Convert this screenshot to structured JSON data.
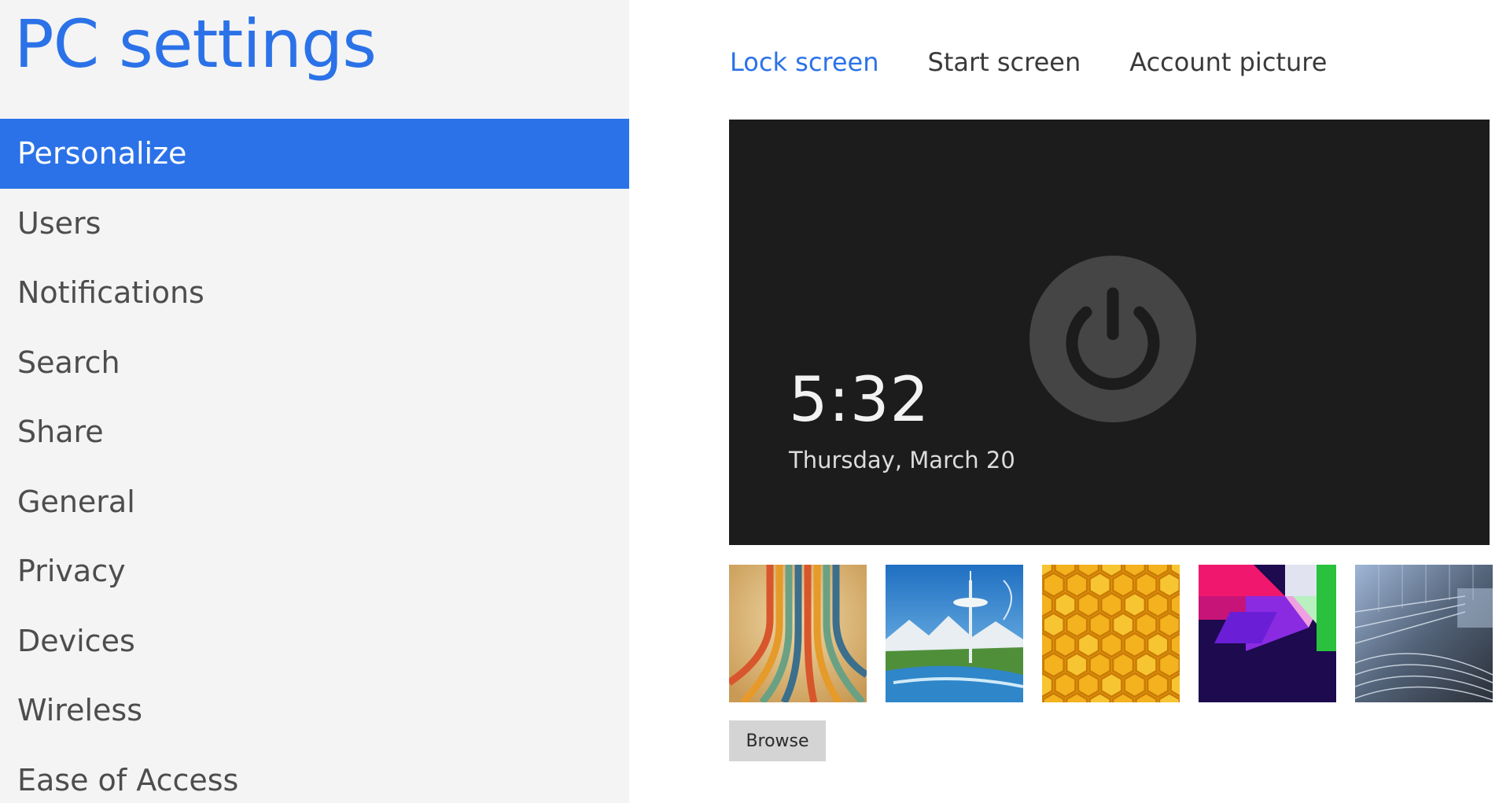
{
  "app": {
    "title": "PC settings"
  },
  "sidebar": {
    "items": [
      {
        "label": "Personalize",
        "selected": true
      },
      {
        "label": "Users"
      },
      {
        "label": "Notifications"
      },
      {
        "label": "Search"
      },
      {
        "label": "Share"
      },
      {
        "label": "General"
      },
      {
        "label": "Privacy"
      },
      {
        "label": "Devices"
      },
      {
        "label": "Wireless"
      },
      {
        "label": "Ease of Access"
      }
    ]
  },
  "main": {
    "tabs": [
      {
        "label": "Lock screen",
        "active": true
      },
      {
        "label": "Start screen"
      },
      {
        "label": "Account picture"
      }
    ],
    "preview": {
      "time": "5:32",
      "date": "Thursday, March 20",
      "icon": "power-icon"
    },
    "thumbnails": [
      {
        "name": "retro-stripes"
      },
      {
        "name": "space-needle"
      },
      {
        "name": "honeycomb"
      },
      {
        "name": "geometric-shapes"
      },
      {
        "name": "light-tunnel"
      }
    ],
    "browse_label": "Browse"
  },
  "colors": {
    "accent": "#2b72e8",
    "sidebar_bg": "#f4f4f4",
    "preview_bg": "#1c1c1c"
  }
}
